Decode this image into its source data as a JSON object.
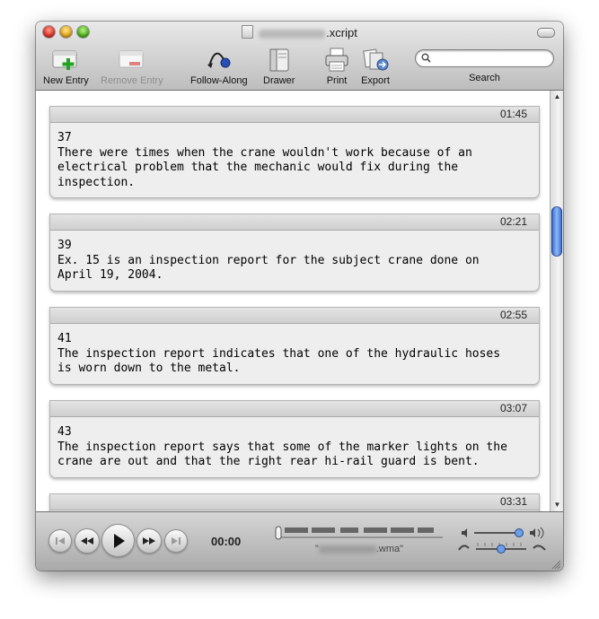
{
  "window": {
    "title_suffix": ".xcript",
    "title_blurred": true
  },
  "toolbar": {
    "new_entry_label": "New Entry",
    "remove_entry_label": "Remove Entry",
    "follow_along_label": "Follow-Along",
    "drawer_label": "Drawer",
    "print_label": "Print",
    "export_label": "Export",
    "search_label": "Search",
    "search_placeholder": ""
  },
  "entries": [
    {
      "time": "01:45",
      "number": "37",
      "text": "There were times when the crane wouldn't work because of an\nelectrical problem that the mechanic would fix during the\ninspection."
    },
    {
      "time": "02:21",
      "number": "39",
      "text": "Ex. 15 is an inspection report for the subject crane done on\nApril 19, 2004."
    },
    {
      "time": "02:55",
      "number": "41",
      "text": "The inspection report indicates that one of the hydraulic hoses\nis worn down to the metal."
    },
    {
      "time": "03:07",
      "number": "43",
      "text": "The inspection report says that some of the marker lights on the\ncrane are out and that the right rear hi-rail guard is bent."
    },
    {
      "time": "03:31",
      "number": "",
      "text": ""
    }
  ],
  "player": {
    "elapsed": "00:00",
    "file_suffix": ".wma",
    "file_prefix_quote": "\"",
    "file_suffix_quote": "\"",
    "volume_level": 0.9,
    "speed_level": 0.5
  },
  "colors": {
    "scroll_thumb": "#4f86df",
    "entry_bg": "#eeeeee",
    "header_bg": "#d9d9d9"
  }
}
